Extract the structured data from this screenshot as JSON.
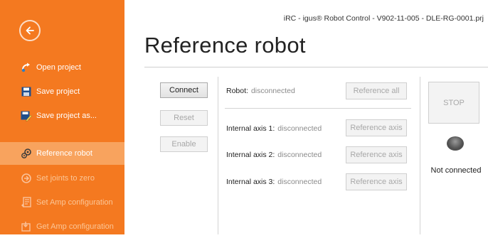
{
  "window_title": "iRC - igus® Robot Control - V902-11-005 - DLE-RG-0001.prj",
  "page_title": "Reference robot",
  "sidebar": {
    "items": [
      {
        "label": "Open project",
        "icon": "open-project-icon"
      },
      {
        "label": "Save project",
        "icon": "save-icon"
      },
      {
        "label": "Save project as...",
        "icon": "save-as-icon"
      },
      {
        "label": "Reference robot",
        "icon": "reference-robot-icon"
      },
      {
        "label": "Set joints to zero",
        "icon": "set-joints-zero-icon"
      },
      {
        "label": "Set Amp configuration",
        "icon": "set-amp-config-icon"
      },
      {
        "label": "Get Amp configuration",
        "icon": "get-amp-config-icon"
      }
    ]
  },
  "controls": {
    "connect": "Connect",
    "reset": "Reset",
    "enable": "Enable"
  },
  "robot": {
    "label": "Robot:",
    "status": "disconnected",
    "reference_all": "Reference all"
  },
  "axes": [
    {
      "label": "Internal axis 1:",
      "status": "disconnected",
      "button": "Reference axis"
    },
    {
      "label": "Internal axis 2:",
      "status": "disconnected",
      "button": "Reference axis"
    },
    {
      "label": "Internal axis 3:",
      "status": "disconnected",
      "button": "Reference axis"
    }
  ],
  "stop": {
    "label": "STOP",
    "connection_status": "Not connected"
  },
  "colors": {
    "sidebar": "#f47920",
    "sidebar_active": "#f8a35e"
  }
}
